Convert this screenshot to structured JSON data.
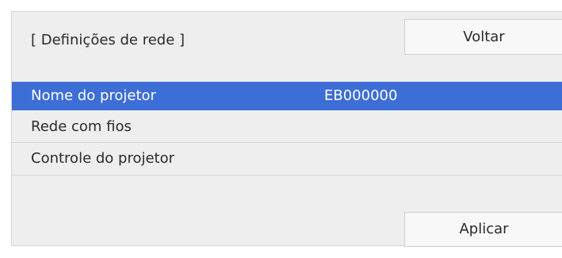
{
  "header": {
    "title": "[ Definições de rede ]",
    "back_label": "Voltar"
  },
  "menu": {
    "items": [
      {
        "label": "Nome do projetor",
        "value": "EB000000",
        "selected": true
      },
      {
        "label": "Rede com fios",
        "value": "",
        "selected": false
      },
      {
        "label": "Controle do projetor",
        "value": "",
        "selected": false
      }
    ]
  },
  "footer": {
    "apply_label": "Aplicar"
  },
  "colors": {
    "selection": "#3d6ed6",
    "panel_background": "#eeeeee",
    "button_background": "#f8f8f8"
  }
}
